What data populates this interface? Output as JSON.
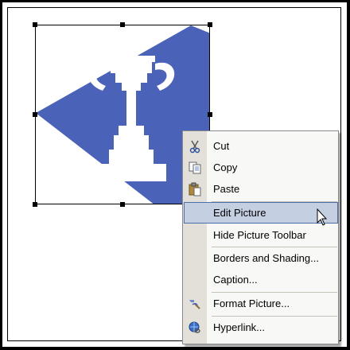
{
  "context_menu": {
    "items": [
      {
        "label": "Cut",
        "icon": "scissors-icon"
      },
      {
        "label": "Copy",
        "icon": "copy-icon"
      },
      {
        "label": "Paste",
        "icon": "clipboard-icon"
      },
      {
        "label": "Edit Picture",
        "icon": "",
        "highlighted": true
      },
      {
        "label": "Hide Picture Toolbar",
        "icon": ""
      },
      {
        "label": "Borders and Shading...",
        "icon": ""
      },
      {
        "label": "Caption...",
        "icon": ""
      },
      {
        "label": "Format Picture...",
        "icon": "format-picture-icon"
      },
      {
        "label": "Hyperlink...",
        "icon": "globe-link-icon"
      }
    ]
  },
  "picture": {
    "subject": "trophy-clipart",
    "fill_color": "#4a63b8"
  },
  "colors": {
    "menu_gutter": "#e2e0d8",
    "menu_highlight": "#c4cfe2",
    "menu_highlight_border": "#4a6ea9"
  }
}
